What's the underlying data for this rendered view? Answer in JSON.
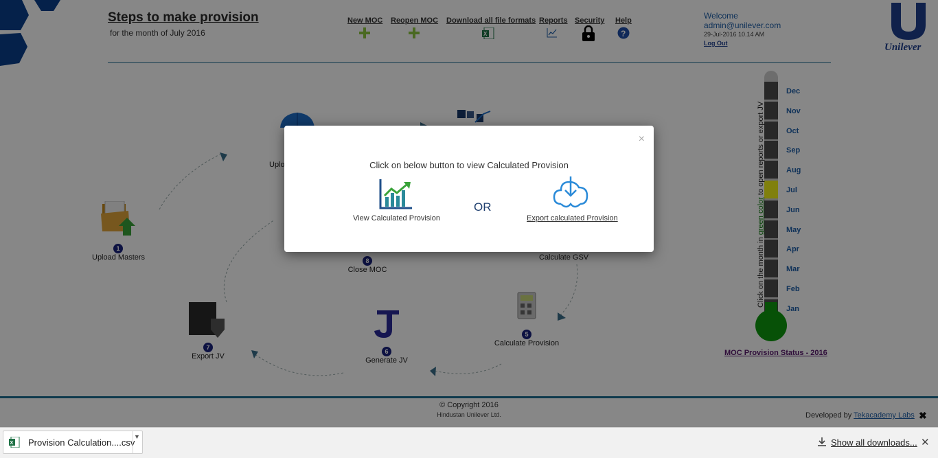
{
  "header": {
    "title": "Steps to make provision",
    "subtitle": "for the month of July 2016"
  },
  "nav": [
    {
      "label": "New MOC",
      "icon": "plus-icon"
    },
    {
      "label": "Reopen MOC",
      "icon": "plus-icon"
    },
    {
      "label": "Download all file formats",
      "icon": "excel-icon"
    },
    {
      "label": "Reports",
      "icon": "chart-icon"
    },
    {
      "label": "Security",
      "icon": "lock-icon"
    },
    {
      "label": "Help",
      "icon": "help-icon"
    }
  ],
  "user": {
    "welcome": "Welcome",
    "email": "admin@unilever.com",
    "datetime": "29-Jul-2016 10.14 AM",
    "logout": "Log Out"
  },
  "brand": {
    "logo_text": "Unilever"
  },
  "steps": [
    {
      "number": "1",
      "label": "Upload Masters",
      "icon": "folder-upload-icon"
    },
    {
      "number": "5",
      "label": "Calculate Provision",
      "icon": "calculator-icon"
    },
    {
      "number": "6",
      "label": "Generate JV",
      "icon": "letter-j-icon"
    },
    {
      "number": "7",
      "label": "Export JV",
      "icon": "export-icon"
    },
    {
      "number": "8",
      "label": "Close MOC",
      "icon": "close-moc-icon"
    },
    {
      "label": "Calculate GSV"
    },
    {
      "label": "Uplo"
    }
  ],
  "thermometer": {
    "months": [
      "Dec",
      "Nov",
      "Oct",
      "Sep",
      "Aug",
      "Jul",
      "Jun",
      "May",
      "Apr",
      "Mar",
      "Feb",
      "Jan"
    ],
    "active_month": "Jul",
    "instruction_before": "Click on the month in ",
    "instruction_highlight": "green color",
    "instruction_after": " to open reports or export JV",
    "status_title": "MOC Provision Status - 2016",
    "colors": {
      "inactive": "#4d4d4d",
      "active": "#f2f21a",
      "bulb": "#0f9a0f"
    }
  },
  "footer": {
    "copyright": "Copyright 2016",
    "company": "Hindustan Unilever Ltd.",
    "developed_by": "Developed by",
    "developer": "Tekacademy Labs"
  },
  "modal": {
    "message": "Click on below button to view Calculated Provision",
    "option_view": "View Calculated Provision",
    "or": "OR",
    "option_export": "Export calculated Provision",
    "close": "×"
  },
  "downloads": {
    "file_name": "Provision Calculation....csv",
    "show_all": "Show all downloads..."
  }
}
